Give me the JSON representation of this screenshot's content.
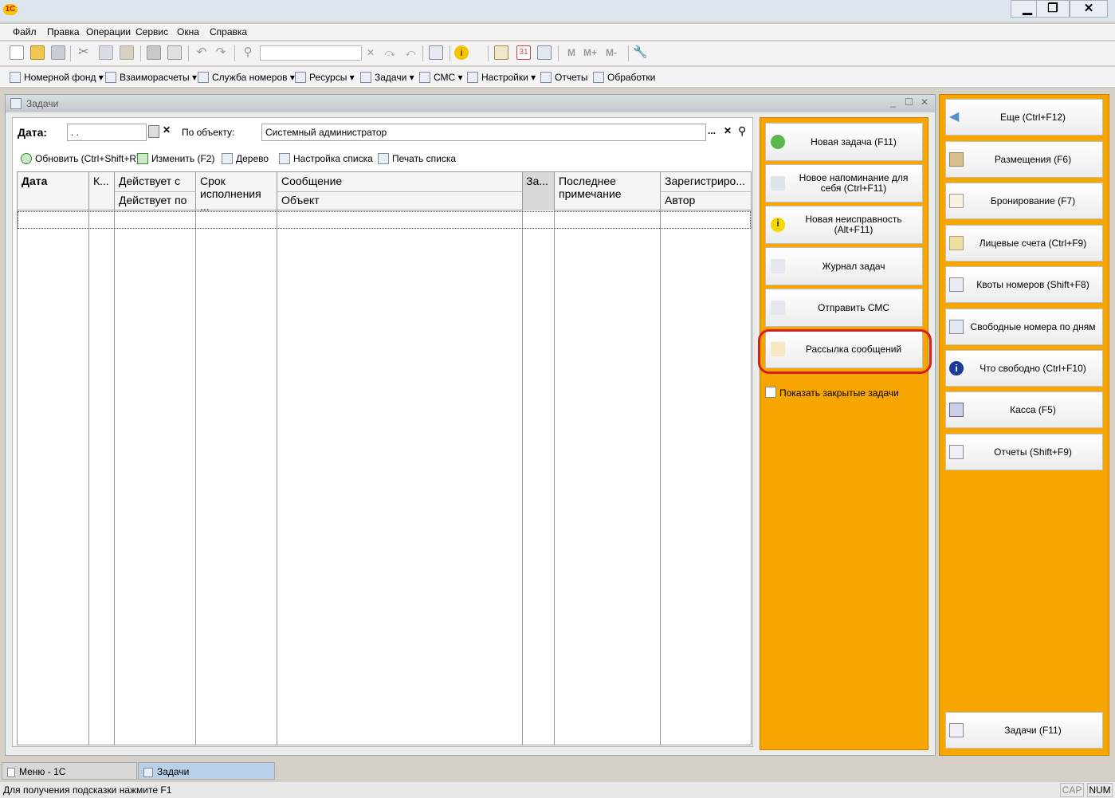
{
  "menu": [
    "Файл",
    "Правка",
    "Операции",
    "Сервис",
    "Окна",
    "Справка"
  ],
  "toolbar2": [
    {
      "label": "Номерной фонд",
      "icon": "book-icon",
      "dropdown": true
    },
    {
      "label": "Взаиморасчеты",
      "icon": "calculator-icon",
      "dropdown": true
    },
    {
      "label": "Служба номеров",
      "icon": "clipboard-icon",
      "dropdown": true
    },
    {
      "label": "Ресурсы",
      "icon": "resources-icon",
      "dropdown": true
    },
    {
      "label": "Задачи",
      "icon": "tasks-icon",
      "dropdown": true
    },
    {
      "label": "СМС",
      "icon": "sms-icon",
      "dropdown": true
    },
    {
      "label": "Настройки",
      "icon": "settings-icon",
      "dropdown": true
    },
    {
      "label": "Отчеты",
      "icon": "report-icon",
      "dropdown": false
    },
    {
      "label": "Обработки",
      "icon": "processing-icon",
      "dropdown": false
    }
  ],
  "window": {
    "title": "Задачи"
  },
  "filter": {
    "date_label": "Дата:",
    "date_value": ". .",
    "object_label": "По объекту:",
    "object_value": "Системный администратор"
  },
  "list_toolbar": [
    {
      "label": "Обновить (Ctrl+Shift+R)",
      "icon": "refresh-icon"
    },
    {
      "label": "Изменить (F2)",
      "icon": "pencil-icon"
    },
    {
      "label": "Дерево",
      "icon": "tree-icon"
    },
    {
      "label": "Настройка списка",
      "icon": "list-settings-icon"
    },
    {
      "label": "Печать списка",
      "icon": "print-icon"
    }
  ],
  "table": {
    "headers": {
      "date": "Дата",
      "k": "К...",
      "valid_from": "Действует с",
      "valid_to": "Действует по",
      "deadline": "Срок исполнения ...",
      "message": "Сообщение",
      "object": "Объект",
      "za": "За...",
      "last_note": "Последнее примечание",
      "registered": "Зарегистриро...",
      "author": "Автор"
    }
  },
  "actions": [
    {
      "label": "Новая задача (F11)",
      "icon": "plus-icon",
      "highlight": false
    },
    {
      "label": "Новое напоминание для себя (Ctrl+F11)",
      "icon": "checkbox-icon",
      "highlight": false
    },
    {
      "label": "Новая неисправность (Alt+F11)",
      "icon": "info-warning-icon",
      "highlight": false
    },
    {
      "label": "Журнал задач",
      "icon": "journal-icon",
      "highlight": false
    },
    {
      "label": "Отправить СМС",
      "icon": "phone-icon",
      "highlight": false
    },
    {
      "label": "Рассылка сообщений",
      "icon": "mail-icon",
      "highlight": true
    }
  ],
  "show_closed_label": "Показать закрытые задачи",
  "right": [
    {
      "label": "Еще (Ctrl+F12)",
      "icon": "back-arrow-icon"
    },
    {
      "label": "Размещения (F6)",
      "icon": "checkin-icon"
    },
    {
      "label": "Бронирование (F7)",
      "icon": "calendar-icon"
    },
    {
      "label": "Лицевые счета (Ctrl+F9)",
      "icon": "account-icon"
    },
    {
      "label": "Квоты номеров (Shift+F8)",
      "icon": "quota-icon"
    },
    {
      "label": "Свободные номера по дням",
      "icon": "chart-icon"
    },
    {
      "label": "Что свободно (Ctrl+F10)",
      "icon": "info-icon"
    },
    {
      "label": "Касса (F5)",
      "icon": "cash-icon"
    },
    {
      "label": "Отчеты (Shift+F9)",
      "icon": "report-icon"
    }
  ],
  "right_bottom": {
    "label": "Задачи (F11)",
    "icon": "tasks-icon"
  },
  "taskbar": [
    "Меню - 1С",
    "Задачи"
  ],
  "status": {
    "hint": "Для получения подсказки нажмите F1",
    "cap": "CAP",
    "num": "NUM"
  },
  "colors": {
    "orange": "#f7a500",
    "highlight_ring": "#d42020",
    "title_bg": "#dde6ee"
  }
}
